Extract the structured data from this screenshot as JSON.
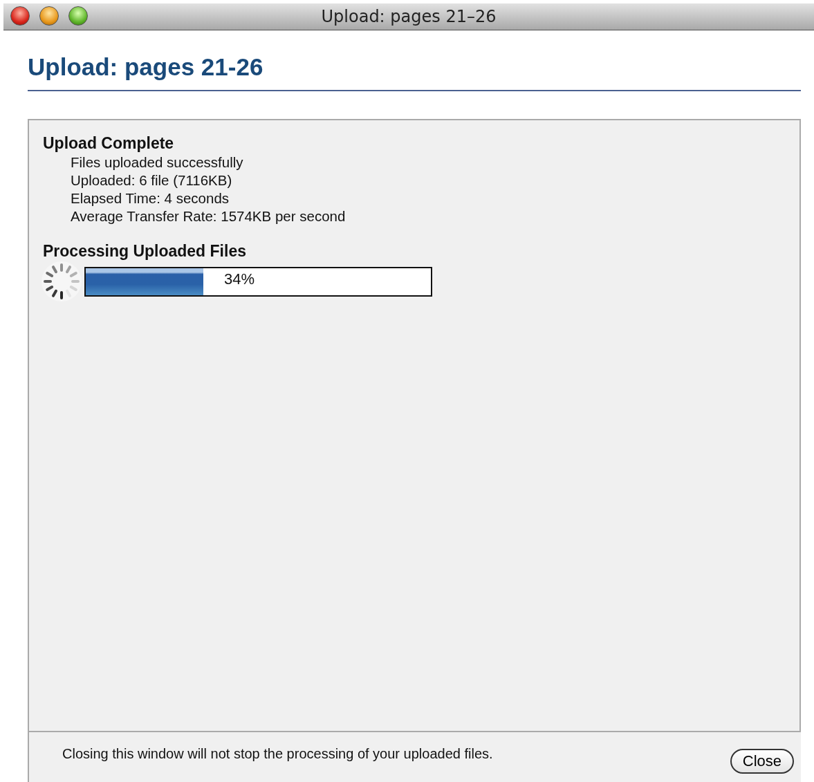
{
  "window": {
    "title": "Upload: pages 21–26"
  },
  "heading": "Upload: pages 21-26",
  "upload_complete": {
    "title": "Upload Complete",
    "lines": [
      "Files uploaded successfully",
      "Uploaded: 6 file (7116KB)",
      "Elapsed Time: 4 seconds",
      "Average Transfer Rate: 1574KB per second"
    ]
  },
  "processing": {
    "title": "Processing Uploaded Files",
    "level": 0.34,
    "reading": "34%"
  },
  "footer": {
    "note": "Closing this window will not stop the processing of your uploaded files.",
    "buttons": [
      "Close"
    ]
  }
}
